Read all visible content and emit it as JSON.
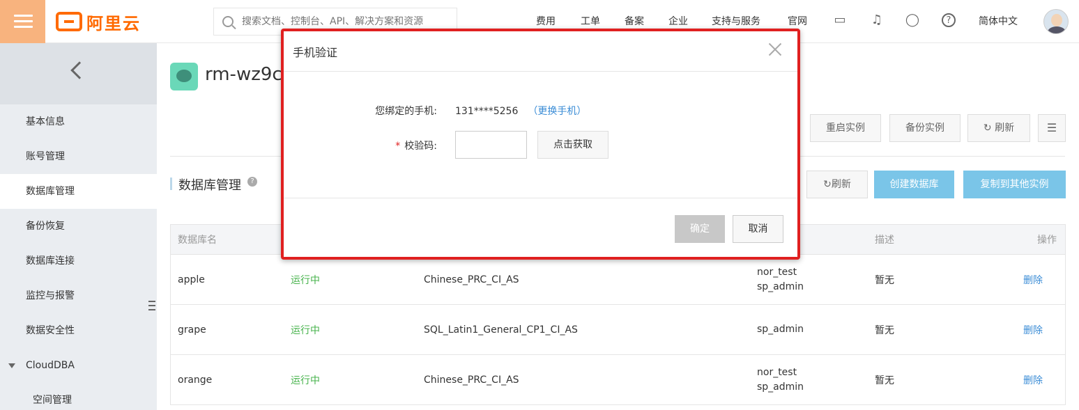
{
  "header": {
    "brand": "阿里云",
    "search_placeholder": "搜索文档、控制台、API、解决方案和资源",
    "nav": [
      "费用",
      "工单",
      "备案",
      "企业",
      "支持与服务",
      "官网"
    ],
    "language": "简体中文",
    "icons": [
      "terminal-icon",
      "bell-icon",
      "cart-icon",
      "help-icon"
    ]
  },
  "sidebar": {
    "items": [
      {
        "label": "基本信息"
      },
      {
        "label": "账号管理"
      },
      {
        "label": "数据库管理"
      },
      {
        "label": "备份恢复"
      },
      {
        "label": "数据库连接"
      },
      {
        "label": "监控与报警"
      },
      {
        "label": "数据安全性"
      },
      {
        "label": "CloudDBA"
      },
      {
        "label": "空间管理"
      }
    ],
    "active": "数据库管理"
  },
  "instance": {
    "title": "rm-wz9c",
    "buttons": {
      "restart": "重启实例",
      "backup": "备份实例",
      "refresh": "刷新"
    }
  },
  "section": {
    "title": "数据库管理",
    "refresh": "刷新",
    "create": "创建数据库",
    "copy": "复制到其他实例"
  },
  "table": {
    "headers": {
      "name": "数据库名",
      "desc": "描述",
      "action": "操作"
    },
    "rows": [
      {
        "name": "apple",
        "status": "运行中",
        "charset": "Chinese_PRC_CI_AS",
        "accounts": [
          "nor_test",
          "sp_admin"
        ],
        "desc": "暂无",
        "action": "删除"
      },
      {
        "name": "grape",
        "status": "运行中",
        "charset": "SQL_Latin1_General_CP1_CI_AS",
        "accounts": [
          "sp_admin"
        ],
        "desc": "暂无",
        "action": "删除"
      },
      {
        "name": "orange",
        "status": "运行中",
        "charset": "Chinese_PRC_CI_AS",
        "accounts": [
          "nor_test",
          "sp_admin"
        ],
        "desc": "暂无",
        "action": "删除"
      }
    ]
  },
  "modal": {
    "title": "手机验证",
    "phone_label": "您绑定的手机:",
    "phone_value": "131****5256",
    "change_phone": "（更换手机）",
    "code_label": "校验码:",
    "required_mark": "*",
    "get_code": "点击获取",
    "ok": "确定",
    "cancel": "取消"
  },
  "colors": {
    "brand": "#ff6a00",
    "menu_bg": "#f8b37e",
    "primary_btn": "#7ac5e8",
    "status_green": "#48b34d",
    "link": "#3a8cd6",
    "highlight_border": "#e02020"
  }
}
